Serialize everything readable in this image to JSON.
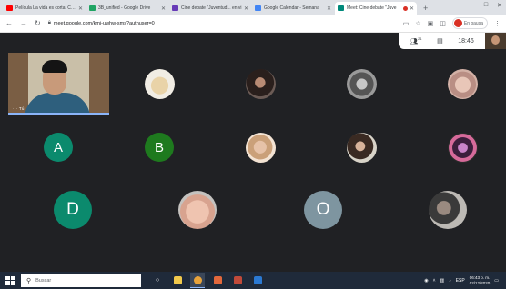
{
  "browser": {
    "tabs": [
      {
        "label": "Película La vida es corta: Capí",
        "favicon_color": "#ff0000",
        "active": false
      },
      {
        "label": "3B_unified - Google Drive",
        "favicon_color": "#1fa463",
        "active": false
      },
      {
        "label": "Cine debate \"Juventud... en vi",
        "favicon_color": "#673ab7",
        "active": false
      },
      {
        "label": "Google Calendar - Semana",
        "favicon_color": "#4285f4",
        "active": false
      },
      {
        "label": "Meet: Cine debate \"Juve",
        "favicon_color": "#00897b",
        "active": true
      }
    ],
    "new_tab": "+",
    "window_controls": [
      "–",
      "□",
      "✕"
    ],
    "url": "meet.google.com/kmj-uwhw-sms?authuser=0",
    "profile_label": "En pausa"
  },
  "meet": {
    "participant_badge": "21",
    "time": "18:46",
    "self_name": "Tú",
    "letter_participants": [
      {
        "letter": "A",
        "color": "#0b8a6d"
      },
      {
        "letter": "B",
        "color": "#1e7a1e"
      },
      {
        "letter": "D",
        "color": "#0b8a6d"
      },
      {
        "letter": "O",
        "color": "#7e95a0"
      }
    ]
  },
  "taskbar": {
    "search_placeholder": "Buscar",
    "clock_time": "06:43 p. m.",
    "clock_date": "02/12/2020",
    "lang": "ESP"
  },
  "colors": {
    "meet_bg": "#202124",
    "accent_blue": "#8ab4f8",
    "taskbar_bg": "#1f2a3a"
  }
}
